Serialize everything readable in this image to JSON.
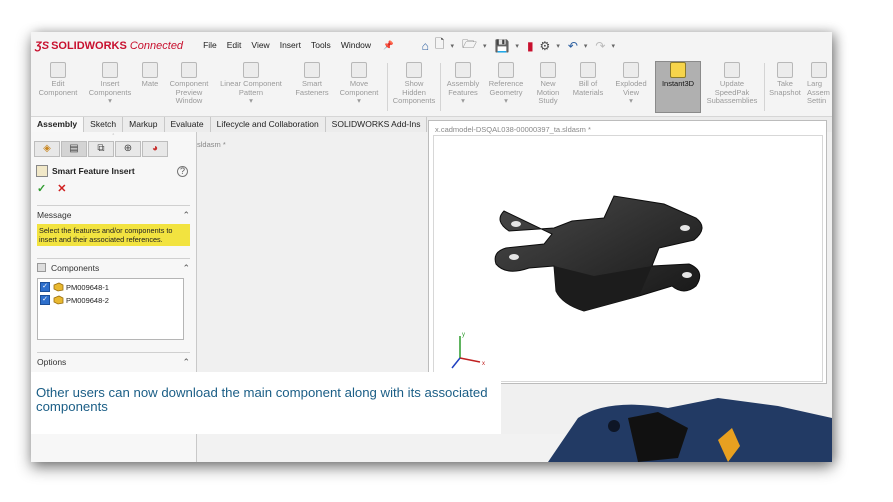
{
  "app": {
    "brand": "SOLIDWORKS",
    "edition": "Connected"
  },
  "menus": [
    "File",
    "Edit",
    "View",
    "Insert",
    "Tools",
    "Window"
  ],
  "ribbon": [
    {
      "label": "Edit Component",
      "lines": [
        "Edit",
        "Component"
      ]
    },
    {
      "label": "Insert Components",
      "lines": [
        "Insert",
        "Components"
      ]
    },
    {
      "label": "Mate",
      "lines": [
        "Mate"
      ]
    },
    {
      "label": "Component Preview Window",
      "lines": [
        "Component",
        "Preview",
        "Window"
      ]
    },
    {
      "label": "Linear Component Pattern",
      "lines": [
        "Linear Component",
        "Pattern"
      ]
    },
    {
      "label": "Smart Fasteners",
      "lines": [
        "Smart",
        "Fasteners"
      ]
    },
    {
      "label": "Move Component",
      "lines": [
        "Move",
        "Component"
      ]
    },
    {
      "label": "Show Hidden Components",
      "lines": [
        "Show",
        "Hidden",
        "Components"
      ]
    },
    {
      "label": "Assembly Features",
      "lines": [
        "Assembly",
        "Features"
      ]
    },
    {
      "label": "Reference Geometry",
      "lines": [
        "Reference",
        "Geometry"
      ]
    },
    {
      "label": "New Motion Study",
      "lines": [
        "New",
        "Motion",
        "Study"
      ]
    },
    {
      "label": "Bill of Materials",
      "lines": [
        "Bill of",
        "Materials"
      ]
    },
    {
      "label": "Exploded View",
      "lines": [
        "Exploded",
        "View"
      ]
    },
    {
      "label": "Instant3D",
      "lines": [
        "Instant3D"
      ]
    },
    {
      "label": "Update SpeedPak Subassemblies",
      "lines": [
        "Update",
        "SpeedPak",
        "Subassemblies"
      ]
    },
    {
      "label": "Take Snapshot",
      "lines": [
        "Take",
        "Snapshot"
      ]
    },
    {
      "label": "Large Assembly Settings",
      "lines": [
        "Larg",
        "Assem",
        "Settin"
      ]
    }
  ],
  "tabs": [
    "Assembly",
    "Sketch",
    "Markup",
    "Evaluate",
    "Lifecycle and Collaboration",
    "SOLIDWORKS Add-Ins"
  ],
  "panel": {
    "title": "Smart Feature Insert",
    "message_header": "Message",
    "message_text": "Select the features and/or components to insert and their associated references.",
    "components_header": "Components",
    "components": [
      "PM009648-1",
      "PM009648-2"
    ],
    "options_header": "Options"
  },
  "background_doc_title": "sldasm *",
  "model_window_title": "x.cadmodel-DSQAL038-00000397_ta.sldasm *",
  "caption": "Other users can now download the main component along with its associated components"
}
